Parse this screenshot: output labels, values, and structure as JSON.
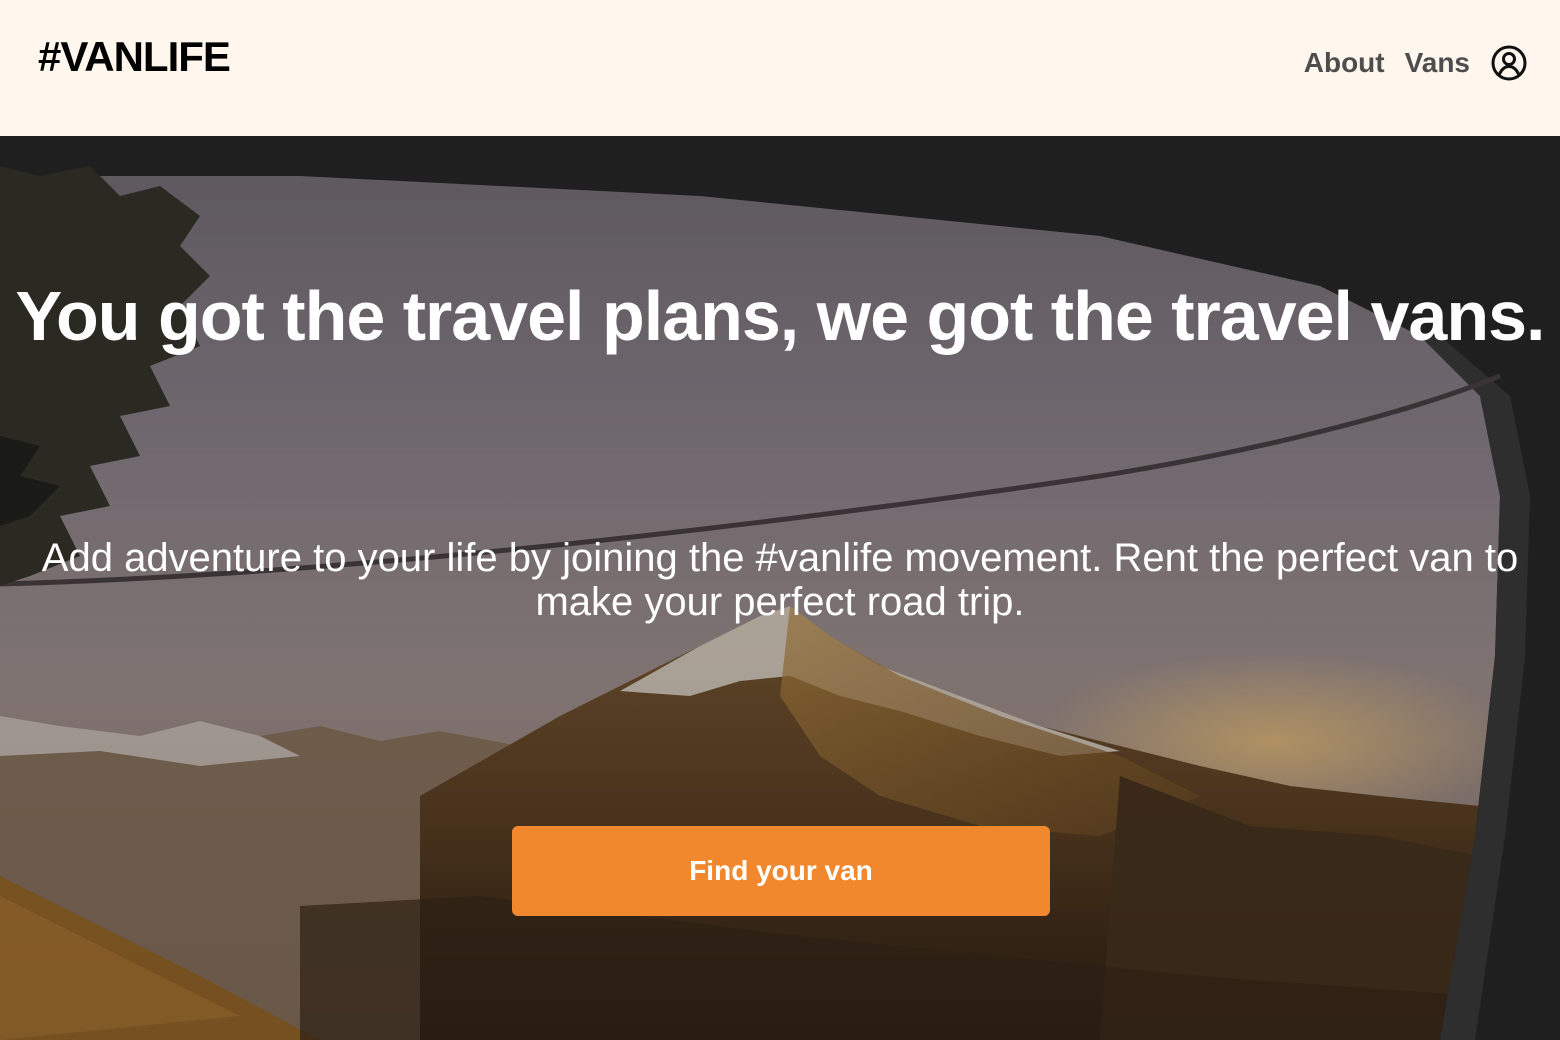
{
  "header": {
    "logo": "#VANLIFE",
    "nav": [
      {
        "label": "About"
      },
      {
        "label": "Vans"
      }
    ],
    "account_icon": "user-circle-icon"
  },
  "hero": {
    "title": "You got the travel plans, we got the travel vans.",
    "subtitle": "Add adventure to your life by joining the #vanlife movement. Rent the perfect van to make your perfect road trip.",
    "cta_label": "Find your van",
    "background_image": "mountain-through-van-window"
  },
  "colors": {
    "header_bg": "#FFF7ED",
    "accent": "#F2882E",
    "nav_text": "#4D4D4D",
    "hero_text": "#FFFFFF"
  }
}
